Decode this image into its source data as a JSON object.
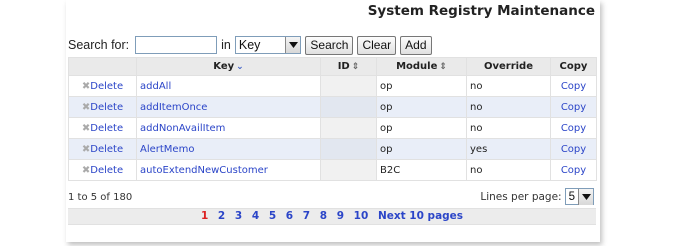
{
  "page": {
    "title": "System Registry Maintenance"
  },
  "search": {
    "label": "Search for:",
    "value": "",
    "in_label": "in",
    "field_selected": "Key",
    "buttons": {
      "search": "Search",
      "clear": "Clear",
      "add": "Add"
    }
  },
  "table": {
    "columns": {
      "key": "Key",
      "id": "ID",
      "module": "Module",
      "override": "Override",
      "copy": "Copy"
    },
    "rows": [
      {
        "delete": "Delete",
        "key": "addAll",
        "id": "",
        "module": "op",
        "override": "no",
        "copy": "Copy"
      },
      {
        "delete": "Delete",
        "key": "addItemOnce",
        "id": "",
        "module": "op",
        "override": "no",
        "copy": "Copy"
      },
      {
        "delete": "Delete",
        "key": "addNonAvailItem",
        "id": "",
        "module": "op",
        "override": "no",
        "copy": "Copy"
      },
      {
        "delete": "Delete",
        "key": "AlertMemo",
        "id": "",
        "module": "op",
        "override": "yes",
        "copy": "Copy"
      },
      {
        "delete": "Delete",
        "key": "autoExtendNewCustomer",
        "id": "",
        "module": "B2C",
        "override": "no",
        "copy": "Copy"
      }
    ]
  },
  "footer": {
    "count_text": "1 to 5 of 180",
    "lines_per_page_label": "Lines per page:",
    "lines_per_page_value": "5"
  },
  "pagination": {
    "current": "1",
    "pages": [
      "2",
      "3",
      "4",
      "5",
      "6",
      "7",
      "8",
      "9",
      "10"
    ],
    "next_label": "Next 10 pages"
  },
  "colors": {
    "link": "#2b45c8",
    "current_page": "#dd2222",
    "alt_row": "#e9eef8",
    "header_bg": "#eaeaea"
  },
  "icons": {
    "delete": "x-icon",
    "sort_active": "chevron-down-icon",
    "sort": "sort-arrows-icon",
    "dropdown": "dropdown-arrow-icon"
  }
}
